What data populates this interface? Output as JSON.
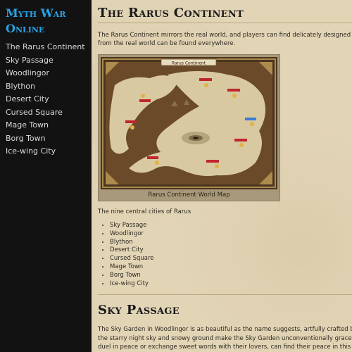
{
  "sidebar": {
    "site_title_line1": "Myth War",
    "site_title_line2": "Online",
    "nav_items": [
      "The Rarus Continent",
      "Sky Passage",
      "Woodlingor",
      "Blython",
      "Desert City",
      "Cursed Square",
      "Mage Town",
      "Borg Town",
      "Ice-wing City"
    ]
  },
  "main": {
    "title": "The Rarus Continent",
    "intro_line1": "The Rarus Continent mirrors the real world, and players can find delicately designed town",
    "intro_line2": "from the real world can be found everywhere.",
    "map": {
      "heading": "Rarus Continent",
      "caption": "Rarus Continent World Map"
    },
    "cities_heading": "The nine central cities of Rarus",
    "cities": [
      "Sky Passage",
      "Woodlingor",
      "Blython",
      "Desert City",
      "Cursed Square",
      "Mage Town",
      "Borg Town",
      "Ice-wing City"
    ],
    "section2_title": "Sky Passage",
    "section2_line1": "The Sky Garden in Woodlingor is as beautiful as the name suggests, artfully crafted by the",
    "section2_line2": "the starry night sky and snowy ground make the Sky Garden unconventionally graceful. In",
    "section2_line3": "duel in peace or exchange sweet words with their lovers, can find their peace in this spec"
  },
  "colors": {
    "sidebar_bg": "#121212",
    "title_accent": "#2aa3e6",
    "content_bg": "#e2d5b6",
    "map_sea": "#4a3520",
    "map_land": "#d8c9a0",
    "map_label": "#c0272d"
  }
}
